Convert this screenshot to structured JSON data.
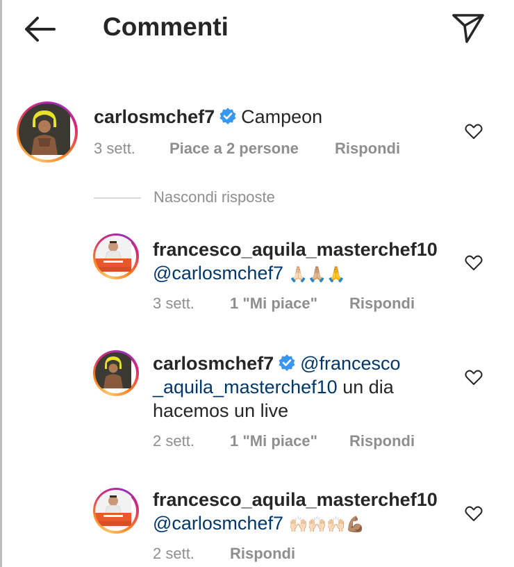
{
  "header": {
    "title": "Commenti",
    "back_icon": "arrow-left-icon",
    "send_icon": "paper-plane-icon"
  },
  "colors": {
    "link": "#00376b",
    "muted": "#8e8e8e",
    "verified": "#3897f0"
  },
  "main_comment": {
    "username": "carlosmchef7",
    "verified": true,
    "text": "Campeon",
    "time": "3 sett.",
    "likes": "Piace a 2 persone",
    "reply": "Rispondi"
  },
  "hide_replies": "Nascondi risposte",
  "replies": [
    {
      "username": "francesco_aquila_masterchef10",
      "mention": "@carlosmchef7",
      "emoji": "🙏🏻🙏🏼🙏",
      "time": "3 sett.",
      "likes": "1 \"Mi piace\"",
      "reply": "Rispondi"
    },
    {
      "username": "carlosmchef7",
      "verified": true,
      "mention_line1": "@francesco",
      "mention_line2": "_aquila_masterchef10",
      "text_line2": " un dia",
      "text_line3": "hacemos un live",
      "time": "2 sett.",
      "likes": "1 \"Mi piace\"",
      "reply": "Rispondi"
    },
    {
      "username": "francesco_aquila_masterchef10",
      "mention": "@carlosmchef7",
      "emoji": "🙌🏻🙌🏻🙌🏻💪🏽",
      "time": "2 sett.",
      "reply": "Rispondi"
    }
  ]
}
